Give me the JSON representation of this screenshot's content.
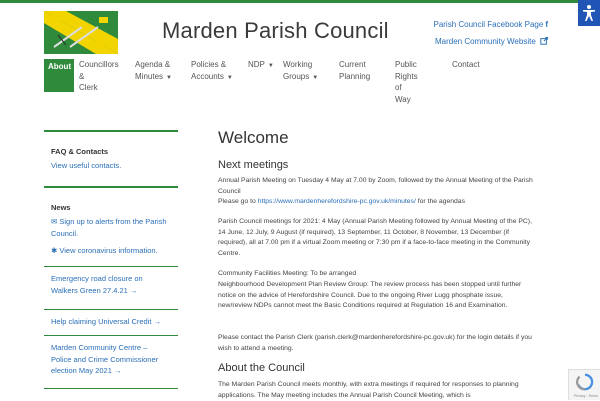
{
  "header": {
    "site_title": "Marden Parish Council",
    "facebook_link": "Parish Council Facebook Page",
    "community_link": "Marden Community Website"
  },
  "nav": {
    "items": [
      {
        "label": "About"
      },
      {
        "label_l1": "Councillors &",
        "label_l2": "Clerk"
      },
      {
        "label_l1": "Agenda &",
        "label_l2": "Minutes"
      },
      {
        "label_l1": "Policies &",
        "label_l2": "Accounts"
      },
      {
        "label_l1": "NDP"
      },
      {
        "label_l1": "Working",
        "label_l2": "Groups"
      },
      {
        "label_l1": "Current",
        "label_l2": "Planning"
      },
      {
        "label_l1": "Public Rights",
        "label_l2": "of Way"
      },
      {
        "label_l1": "Contact"
      }
    ]
  },
  "sidebar": {
    "faq_heading": "FAQ & Contacts",
    "faq_link": "View useful contacts.",
    "news_heading": "News",
    "news_link1": "Sign up to alerts from the Parish Council.",
    "news_link2": "View coronavirus information.",
    "post1": "Emergency road closure on Walkers Green 27.4.21 →",
    "post2": "Help claiming Universal Credit →",
    "post3": "Marden Community Centre – Police and Crime Commissioner election May 2021 →"
  },
  "main": {
    "title": "Welcome",
    "next_meetings_heading": "Next meetings",
    "p1a": "Annual Parish Meeting on Tuesday 4 May at 7.00 by Zoom, followed by the Annual Meeting of the Parish Council",
    "p1b_prefix": "Please go to ",
    "p1b_link": "https://www.mardenherefordshire-pc.gov.uk/minutes/",
    "p1b_suffix": " for the agendas",
    "p2": "Parish Council meetings for 2021: 4 May (Annual Parish Meeting followed by Annual Meeting of the PC), 14 June, 12 July, 9 August (if required), 13 September, 11 October, 8 November, 13 December (if required), all at 7.00 pm if a virtual Zoom meeting or 7:30 pm if a face-to-face meeting in the Community Centre.",
    "p3a": "Community Facilities Meeting: To be arranged",
    "p3b": "Neighbourhood Development Plan Review Group: The review process has been stopped until further notice on the advice of Herefordshire Council. Due to the ongoing River Lugg phosphate issue, new/review NDPs cannot meet the Basic Conditions required at Regulation 16 and Examination.",
    "p4": "Please contact the Parish Clerk (parish.clerk@mardenherefordshire-pc.gov.uk) for the login details if you wish to attend a meeting.",
    "about_heading": "About the Council",
    "p5": "The Marden Parish Council meets monthly, with extra meetings if required for responses to planning applications. The May meeting includes the Annual Parish Council Meeting, which is"
  },
  "recaptcha": {
    "label": "Privacy - Terms"
  },
  "colors": {
    "accent": "#2f8a3b",
    "link": "#2b6fb6",
    "logo_yellow": "#f2d400",
    "access_blue": "#2055b5"
  }
}
